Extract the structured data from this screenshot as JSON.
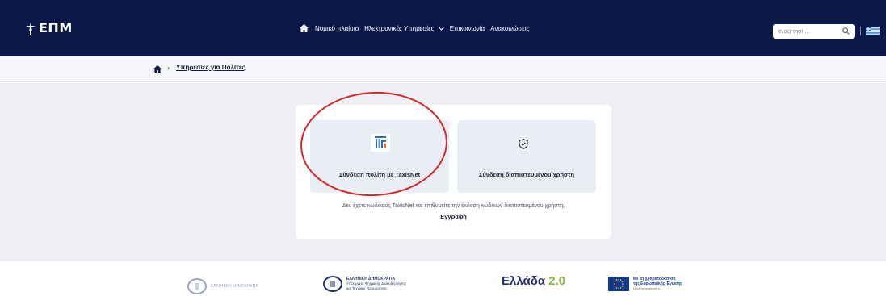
{
  "header": {
    "logo_text": "ΕΠΜ",
    "nav": {
      "legal": "Νομικό πλαίσιο",
      "e_services": "Ηλεκτρονικές Υπηρεσίες",
      "contact": "Επικοινωνία",
      "announcements": "Ανακοινώσεις"
    },
    "search": {
      "placeholder": "αναζήτηση..."
    }
  },
  "breadcrumb": {
    "current": "Υπηρεσίες για Πολίτες"
  },
  "login": {
    "taxisnet_label": "Σύνδεση πολίτη με TaxisNet",
    "certified_label": "Σύνδεση διαπιστευμένου χρήστη",
    "note": "Δεν έχετε κωδικούς TaxisNet και επιθυμείτε την έκδοση κωδικών διαπιστευμένου χρήστη;",
    "register": "Εγγραφή"
  },
  "footer": {
    "gov_1": "ΕΛΛΗΝΙΚΗ ΔΗΜΟΚΡΑΤΙΑ",
    "gov_2_title": "ΕΛΛΗΝΙΚΗ ΔΗΜΟΚΡΑΤΙΑ",
    "gov_2_line1": "Υπουργείο Ψηφιακής Διακυβέρνησης",
    "gov_2_line2": "και Τεχνικής Νοημοσύνης",
    "greece2_main": "Ελλάδα",
    "greece2_version": "2.0",
    "eu_line1": "Με τη χρηματοδότηση",
    "eu_line2": "της Ευρωπαϊκής Ένωσης",
    "eu_line3": "NextGenerationEU"
  },
  "colors": {
    "navbar": "#0b1848",
    "accent_ring": "#d9262a",
    "card_option": "#e9edf4"
  },
  "icons": [
    "home-icon",
    "chevron-down-icon",
    "search-icon",
    "greek-flag-icon",
    "taxisnet-logo-icon",
    "shield-check-icon"
  ]
}
